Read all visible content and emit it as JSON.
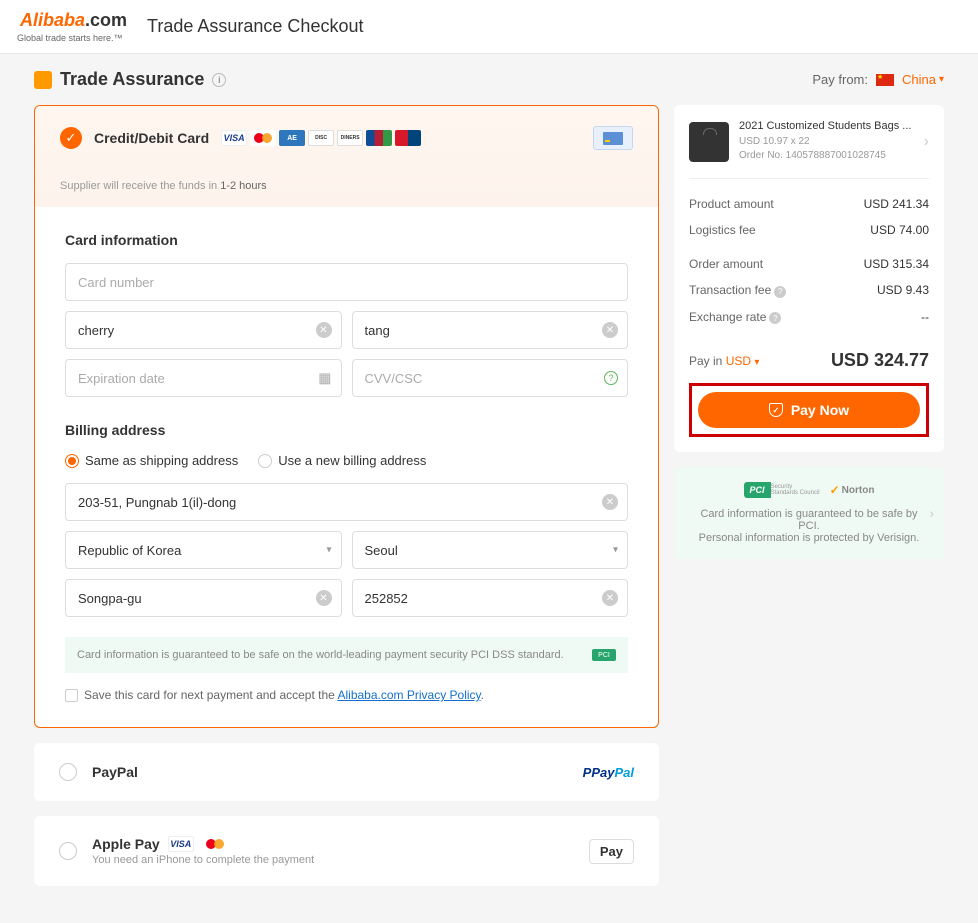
{
  "header": {
    "logo_ali": "Alibaba",
    "logo_com": ".com",
    "tagline": "Global trade starts here.™",
    "title": "Trade Assurance Checkout"
  },
  "page": {
    "trade_assurance": "Trade Assurance",
    "pay_from_label": "Pay from:",
    "pay_from_country": "China"
  },
  "credit_card": {
    "label": "Credit/Debit Card",
    "funds_note_a": "Supplier will receive the funds in",
    "funds_note_b": "1-2 hours",
    "section_card": "Card information",
    "card_number_ph": "Card number",
    "first_name": "cherry",
    "last_name": "tang",
    "exp_ph": "Expiration date",
    "cvv_ph": "CVV/CSC",
    "section_billing": "Billing address",
    "opt_same": "Same as shipping address",
    "opt_new": "Use a new billing address",
    "address": "203-51, Pungnab 1(il)-dong",
    "country": "Republic of Korea",
    "city": "Seoul",
    "district": "Songpa-gu",
    "postal": "252852",
    "pci_note": "Card information is guaranteed to be safe on the world-leading payment security PCI DSS standard.",
    "save_label": "Save this card for next payment and accept the ",
    "privacy_link": "Alibaba.com Privacy Policy"
  },
  "paypal": {
    "label": "PayPal"
  },
  "applepay": {
    "label": "Apple Pay",
    "sub": "You need an iPhone to complete the payment",
    "badge": "Pay"
  },
  "order": {
    "product_title": "2021 Customized Students Bags ...",
    "product_price": "USD 10.97 x 22",
    "order_no": "Order No. 140578887001028745",
    "product_amount_l": "Product amount",
    "product_amount_v": "USD 241.34",
    "logistics_l": "Logistics fee",
    "logistics_v": "USD 74.00",
    "order_amount_l": "Order amount",
    "order_amount_v": "USD 315.34",
    "transaction_l": "Transaction fee",
    "transaction_v": "USD 9.43",
    "exchange_l": "Exchange rate",
    "exchange_v": "--",
    "pay_in_l": "Pay in",
    "pay_in_cur": "USD",
    "total": "USD 324.77",
    "pay_btn": "Pay Now"
  },
  "trust": {
    "line1": "Card information is guaranteed to be safe by PCI.",
    "line2": "Personal information is protected by Verisign."
  }
}
